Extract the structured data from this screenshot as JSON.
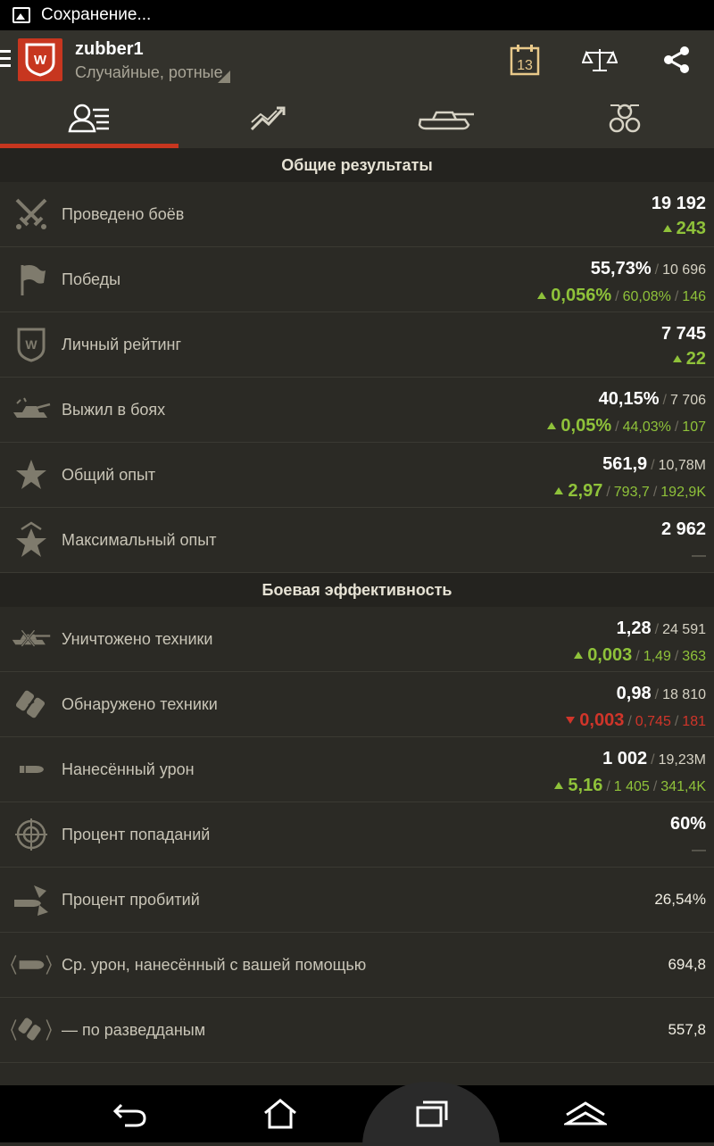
{
  "status_bar": {
    "text": "Сохранение..."
  },
  "header": {
    "username": "zubber1",
    "mode": "Случайные, ротные",
    "calendar_day": "13"
  },
  "tabs": [
    {
      "icon": "profile-stats-icon",
      "active": true
    },
    {
      "icon": "trend-chart-icon",
      "active": false
    },
    {
      "icon": "tank-icon",
      "active": false
    },
    {
      "icon": "medals-icon",
      "active": false
    }
  ],
  "sections": {
    "general": {
      "title": "Общие результаты"
    },
    "battle": {
      "title": "Боевая эффективность"
    }
  },
  "rows": {
    "battles": {
      "label": "Проведено боёв",
      "value": "19 192",
      "delta": "243"
    },
    "wins": {
      "label": "Победы",
      "value": "55,73%",
      "total": "10 696",
      "delta": "0,056%",
      "sub1": "60,08%",
      "sub2": "146"
    },
    "rating": {
      "label": "Личный рейтинг",
      "value": "7 745",
      "delta": "22"
    },
    "survived": {
      "label": "Выжил в боях",
      "value": "40,15%",
      "total": "7 706",
      "delta": "0,05%",
      "sub1": "44,03%",
      "sub2": "107"
    },
    "xp": {
      "label": "Общий опыт",
      "value": "561,9",
      "total": "10,78M",
      "delta": "2,97",
      "sub1": "793,7",
      "sub2": "192,9K"
    },
    "max_xp": {
      "label": "Максимальный опыт",
      "value": "2 962",
      "delta": "—"
    },
    "destroyed": {
      "label": "Уничтожено техники",
      "value": "1,28",
      "total": "24 591",
      "delta": "0,003",
      "sub1": "1,49",
      "sub2": "363"
    },
    "spotted": {
      "label": "Обнаружено техники",
      "value": "0,98",
      "total": "18 810",
      "delta": "0,003",
      "sub1": "0,745",
      "sub2": "181"
    },
    "damage": {
      "label": "Нанесённый урон",
      "value": "1 002",
      "total": "19,23M",
      "delta": "5,16",
      "sub1": "1 405",
      "sub2": "341,4K"
    },
    "hit_rate": {
      "label": "Процент попаданий",
      "value": "60%",
      "delta": "—"
    },
    "pen_rate": {
      "label": "Процент пробитий",
      "value": "26,54%"
    },
    "assist": {
      "label": "Ср. урон, нанесённый с вашей помощью",
      "value": "694,8"
    },
    "scout": {
      "label": "— по разведданым",
      "value": "557,8"
    }
  },
  "colors": {
    "positive": "#8fc23a",
    "negative": "#d0352a",
    "accent": "#c7361f"
  }
}
